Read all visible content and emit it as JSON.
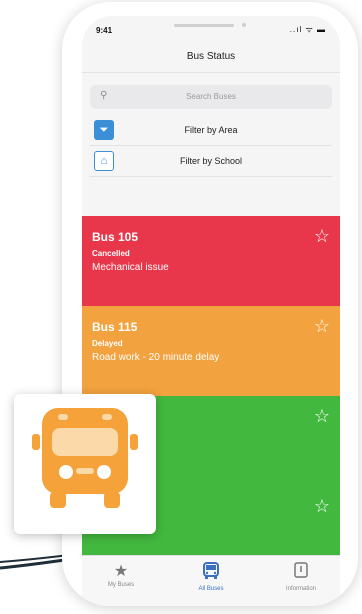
{
  "status_bar": {
    "time": "9:41",
    "signal": "..ıl ᯤ ▬"
  },
  "header": {
    "title": "Bus Status"
  },
  "search": {
    "placeholder": "Search Buses"
  },
  "filters": [
    {
      "label": "Filter by Area",
      "icon": "filter-icon"
    },
    {
      "label": "Filter by School",
      "icon": "school-icon"
    }
  ],
  "buses": [
    {
      "name": "Bus 105",
      "status": "Cancelled",
      "note": "Mechanical issue",
      "color": "#e8364a"
    },
    {
      "name": "Bus 115",
      "status": "Delayed",
      "note": "Road work - 20 minute delay",
      "color": "#f2a23e"
    },
    {
      "name": "",
      "status": "",
      "note": "",
      "color": "#43b83f"
    },
    {
      "name": "",
      "status": "",
      "note": "",
      "color": "#43b83f"
    }
  ],
  "tabs": [
    {
      "label": "My Buses",
      "icon": "star-icon"
    },
    {
      "label": "All Buses",
      "icon": "bus-icon"
    },
    {
      "label": "Information",
      "icon": "info-icon"
    }
  ],
  "colors": {
    "accent": "#3a8fd6",
    "cancelled": "#e8364a",
    "delayed": "#f2a23e",
    "on_time": "#43b83f",
    "bus_logo": "#f5a23a"
  }
}
